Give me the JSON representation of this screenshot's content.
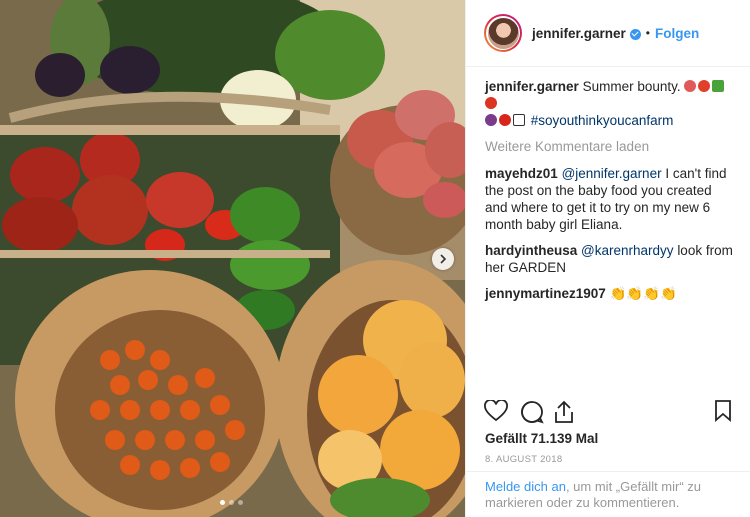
{
  "header": {
    "username": "jennifer.garner",
    "separator": "•",
    "follow_label": "Folgen"
  },
  "caption": {
    "username": "jennifer.garner",
    "text": "Summer bounty.",
    "hashtag": "#soyouthinkyoucanfarm"
  },
  "load_more_label": "Weitere Kommentare laden",
  "comments": [
    {
      "username": "mayehdz01",
      "mention": "@jennifer.garner",
      "text": "I can't find the post on the baby food you created and where to get it to try on my new 6 month baby girl Eliana."
    },
    {
      "username": "hardyintheusa",
      "mention": "@karenrhardyy",
      "text": "look from her GARDEN"
    },
    {
      "username": "jennymartinez1907",
      "mention": "",
      "text": "👏👏👏👏"
    }
  ],
  "likes_text": "Gefällt 71.139 Mal",
  "date_text": "8. AUGUST 2018",
  "login_prompt": {
    "link": "Melde dich an",
    "text": ", um mit „Gefällt mir“ zu markieren oder zu kommentieren."
  },
  "colors": {
    "accent": "#3897f0",
    "text": "#262626",
    "muted": "#999999"
  },
  "carousel": {
    "slide_count": 3,
    "active_index": 0
  }
}
